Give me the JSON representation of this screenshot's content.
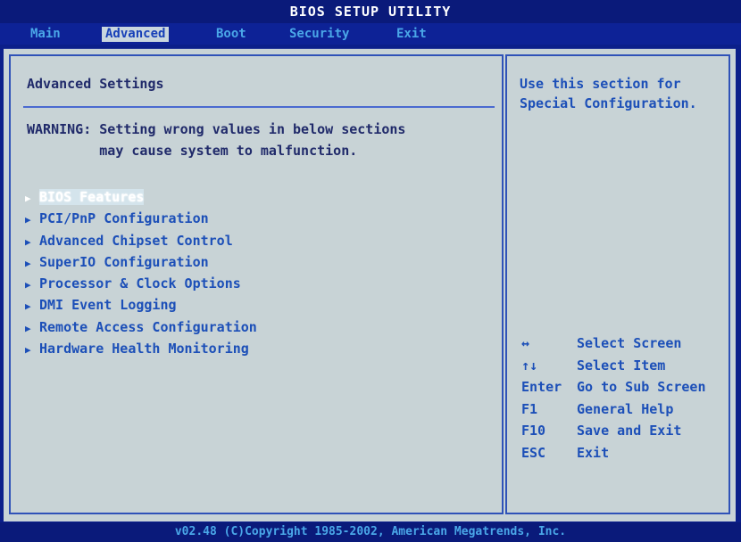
{
  "title": "BIOS SETUP UTILITY",
  "menu": [
    {
      "label": "Main",
      "active": false
    },
    {
      "label": "Advanced",
      "active": true
    },
    {
      "label": "Boot",
      "active": false
    },
    {
      "label": "Security",
      "active": false
    },
    {
      "label": "Exit",
      "active": false
    }
  ],
  "main": {
    "heading": "Advanced Settings",
    "warning": "WARNING: Setting wrong values in below sections\n         may cause system to malfunction.",
    "items": [
      {
        "label": "BIOS Features",
        "selected": true
      },
      {
        "label": "PCI/PnP Configuration",
        "selected": false
      },
      {
        "label": "Advanced Chipset Control",
        "selected": false
      },
      {
        "label": "SuperIO Configuration",
        "selected": false
      },
      {
        "label": "Processor & Clock Options",
        "selected": false
      },
      {
        "label": "DMI Event Logging",
        "selected": false
      },
      {
        "label": "Remote Access Configuration",
        "selected": false
      },
      {
        "label": "Hardware Health Monitoring",
        "selected": false
      }
    ]
  },
  "help": {
    "text": "Use this section for Special Configuration.",
    "keys": [
      {
        "key": "↔",
        "action": "Select Screen"
      },
      {
        "key": "↑↓",
        "action": "Select Item"
      },
      {
        "key": "Enter",
        "action": "Go to Sub Screen"
      },
      {
        "key": "F1",
        "action": "General Help"
      },
      {
        "key": "F10",
        "action": "Save and Exit"
      },
      {
        "key": "ESC",
        "action": "Exit"
      }
    ]
  },
  "footer": "v02.48 (C)Copyright 1985-2002, American Megatrends, Inc.",
  "colors": {
    "background": "#c8d3d6",
    "frame": "#0b1f8a",
    "item_text": "#1c4fb8",
    "heading_text": "#202a6a"
  }
}
